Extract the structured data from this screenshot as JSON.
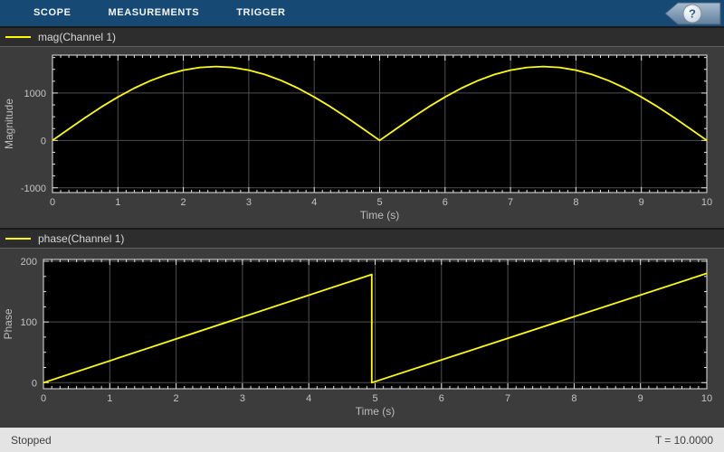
{
  "toolbar": {
    "tabs": [
      {
        "label": "SCOPE"
      },
      {
        "label": "MEASUREMENTS"
      },
      {
        "label": "TRIGGER"
      }
    ],
    "help_glyph": "?"
  },
  "legends": {
    "mag": "mag(Channel 1)",
    "phase": "phase(Channel 1)"
  },
  "status": {
    "left": "Stopped",
    "right": "T = 10.0000"
  },
  "colors": {
    "toolbar_bg": "#164a74",
    "figure_bg": "#3c3c3c",
    "legend_bg": "#2d2d2d",
    "signal_yellow": "#ffff00",
    "status_bg": "#e4e4e4",
    "help_chevron": "#7d99b4"
  },
  "chart_style": {
    "plot_bg": "#000000",
    "grid": "#4f4f4f",
    "axis": "#e4e4e4",
    "tick_label": "#c4c4c4",
    "axis_label": "#bdbdbd",
    "tick_label_size": 11,
    "axis_label_size": 12,
    "line_width": 1.8
  },
  "chart_data": [
    {
      "type": "line",
      "title": "mag(Channel 1)",
      "xlabel": "Time (s)",
      "ylabel": "Magnitude",
      "xlim": [
        0,
        10
      ],
      "ylim": [
        -1100,
        1800
      ],
      "xticks": [
        0,
        1,
        2,
        3,
        4,
        5,
        6,
        7,
        8,
        9,
        10
      ],
      "yticks": [
        -1000,
        0,
        1000
      ],
      "x_minor_step": 0.125,
      "y_minor_step": 250,
      "grid": true,
      "legend_position": "top-strip",
      "series": [
        {
          "name": "mag(Channel 1)",
          "color": "#ffff00",
          "x": [
            0,
            0.25,
            0.5,
            0.75,
            1,
            1.25,
            1.5,
            1.75,
            2,
            2.25,
            2.5,
            2.75,
            3,
            3.25,
            3.5,
            3.75,
            4,
            4.25,
            4.5,
            4.75,
            5,
            5.25,
            5.5,
            5.75,
            6,
            6.25,
            6.5,
            6.75,
            7,
            7.25,
            7.5,
            7.75,
            8,
            8.25,
            8.5,
            8.75,
            9,
            9.25,
            9.5,
            9.75,
            10
          ],
          "y": [
            0,
            244,
            482,
            708,
            917,
            1103,
            1262,
            1390,
            1484,
            1541,
            1560,
            1541,
            1484,
            1390,
            1262,
            1103,
            917,
            708,
            482,
            244,
            0,
            244,
            482,
            708,
            917,
            1103,
            1262,
            1390,
            1484,
            1541,
            1560,
            1541,
            1484,
            1390,
            1262,
            1103,
            917,
            708,
            482,
            244,
            0
          ]
        }
      ]
    },
    {
      "type": "line",
      "title": "phase(Channel 1)",
      "xlabel": "Time (s)",
      "ylabel": "Phase",
      "xlim": [
        0,
        10
      ],
      "ylim": [
        -10,
        203
      ],
      "xticks": [
        0,
        1,
        2,
        3,
        4,
        5,
        6,
        7,
        8,
        9,
        10
      ],
      "yticks": [
        0,
        100,
        200
      ],
      "x_minor_step": 0.125,
      "y_minor_step": 25,
      "grid": true,
      "legend_position": "top-strip",
      "series": [
        {
          "name": "phase(Channel 1)",
          "color": "#ffff00",
          "x": [
            0,
            4.95,
            4.95,
            10
          ],
          "y": [
            0,
            178.2,
            0,
            180
          ]
        }
      ]
    }
  ]
}
